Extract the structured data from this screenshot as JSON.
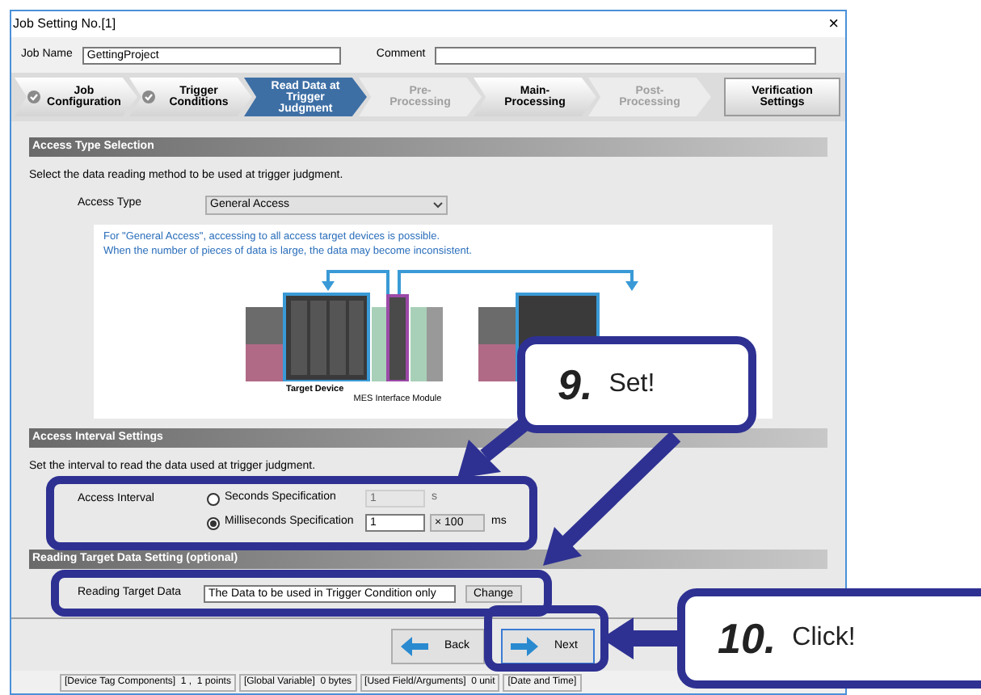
{
  "window": {
    "title": "Job Setting No.[1]",
    "close": "×"
  },
  "job_name": {
    "label": "Job Name",
    "value": "GettingProject"
  },
  "comment": {
    "label": "Comment"
  },
  "steps": [
    {
      "label": "Job Configuration",
      "completed": true,
      "selected": false,
      "disabled": false
    },
    {
      "label": "Trigger Conditions",
      "completed": true,
      "selected": false,
      "disabled": false
    },
    {
      "label": "Read Data at Trigger Judgment",
      "completed": false,
      "selected": true,
      "disabled": false
    },
    {
      "label": "Pre-Processing",
      "completed": false,
      "selected": false,
      "disabled": true
    },
    {
      "label": "Main-Processing",
      "completed": false,
      "selected": false,
      "disabled": false
    },
    {
      "label": "Post-Processing",
      "completed": false,
      "selected": false,
      "disabled": true
    }
  ],
  "verification_button": "Verification Settings",
  "access_type_section": {
    "heading": "Access Type Selection",
    "description": "Select the data reading method to be used at trigger judgment.",
    "label": "Access Type",
    "value": "General Access",
    "info": [
      "For \"General Access\", accessing to all access target devices is possible.",
      "When the number of pieces of data is large, the data may become inconsistent."
    ],
    "diagram_labels": [
      "Target Device",
      "MES Interface Module"
    ]
  },
  "access_interval_section": {
    "heading": "Access Interval Settings",
    "description": "Set the interval to read the data used at trigger judgment.",
    "label": "Access Interval",
    "options": [
      {
        "label": "Seconds Specification",
        "selected": false,
        "value": "1",
        "unit": "s",
        "disabled": true
      },
      {
        "label": "Milliseconds Specification",
        "selected": true,
        "value": "1",
        "multiplier": "× 100",
        "unit": "ms",
        "disabled": false
      }
    ]
  },
  "reading_section": {
    "heading": "Reading Target Data Setting (optional)",
    "label": "Reading Target Data",
    "value": "The Data to be used in Trigger Condition only",
    "button": "Change"
  },
  "buttons": [
    {
      "label": "Back",
      "kind": "back"
    },
    {
      "label": "Next",
      "kind": "next"
    }
  ],
  "status_bar": [
    "[Device Tag Components]  1 ,  1 points",
    "[Global Variable]  0 bytes",
    "[Used Field/Arguments]  0 unit",
    "[Date and Time]"
  ],
  "callouts": [
    {
      "number": "9.",
      "text": "Set!"
    },
    {
      "number": "10.",
      "text": "Click!"
    }
  ]
}
